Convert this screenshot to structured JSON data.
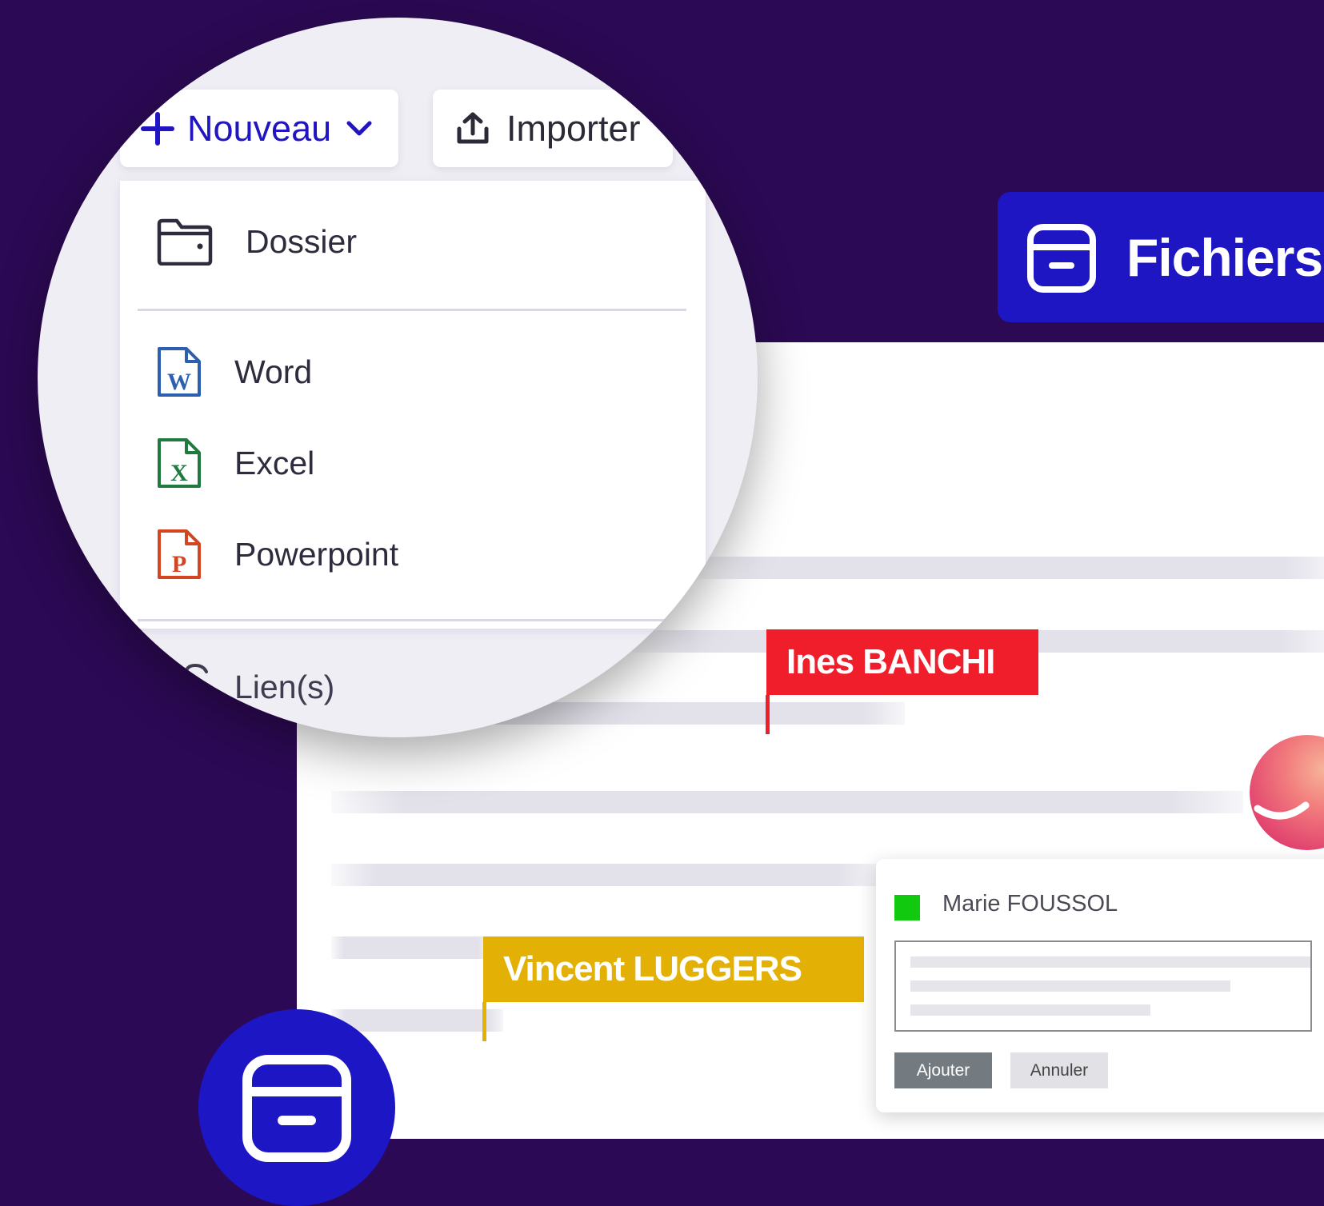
{
  "toolbar": {
    "new_label": "Nouveau",
    "import_label": "Importer"
  },
  "new_menu": {
    "items": [
      {
        "label": "Dossier",
        "icon": "folder-icon"
      },
      {
        "label": "Word",
        "icon": "word-file-icon"
      },
      {
        "label": "Excel",
        "icon": "excel-file-icon"
      },
      {
        "label": "Powerpoint",
        "icon": "powerpoint-file-icon"
      },
      {
        "label": "Lien(s)",
        "icon": "link-icon"
      }
    ]
  },
  "files_badge": {
    "title": "Fichiers",
    "icon": "archive-icon"
  },
  "collaborators": [
    {
      "name": "Ines BANCHI",
      "color": "#f01e2a"
    },
    {
      "name": "Vincent LUGGERS",
      "color": "#e3b106"
    }
  ],
  "comment": {
    "author": "Marie FOUSSOL",
    "status_color": "#11c90f",
    "add_label": "Ajouter",
    "cancel_label": "Annuler"
  },
  "colors": {
    "background": "#2c0954",
    "brand_blue": "#1e16c3",
    "accent_blue": "#2015c0"
  }
}
